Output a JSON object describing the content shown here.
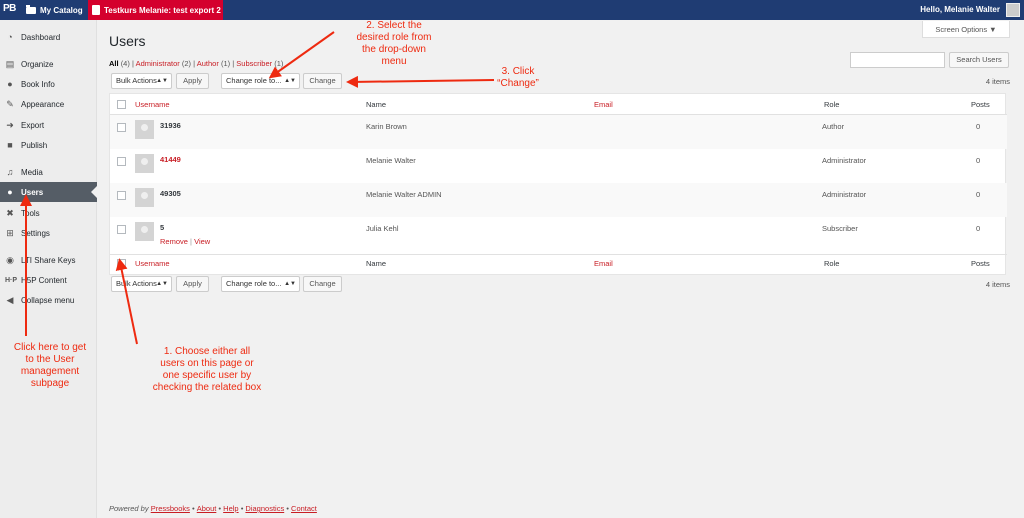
{
  "adminbar": {
    "logo": "PB",
    "catalog": "My Catalog",
    "book": "Testkurs Melanie: test export 2",
    "greeting": "Hello, Melanie Walter"
  },
  "sidebar": {
    "items": [
      {
        "label": "Dashboard",
        "icon": "gauge-icon"
      },
      {
        "label": "Organize",
        "icon": "organize-icon"
      },
      {
        "label": "Book Info",
        "icon": "info-icon"
      },
      {
        "label": "Appearance",
        "icon": "brush-icon"
      },
      {
        "label": "Export",
        "icon": "export-icon"
      },
      {
        "label": "Publish",
        "icon": "publish-icon"
      },
      {
        "label": "Media",
        "icon": "media-icon"
      },
      {
        "label": "Users",
        "icon": "user-icon",
        "active": true
      },
      {
        "label": "Tools",
        "icon": "wrench-icon"
      },
      {
        "label": "Settings",
        "icon": "settings-icon"
      },
      {
        "label": "LTI Share Keys",
        "icon": "lti-icon"
      },
      {
        "label": "H5P Content",
        "icon": "h5p-icon"
      },
      {
        "label": "Collapse menu",
        "icon": "collapse-icon"
      }
    ]
  },
  "page": {
    "title": "Users",
    "screen_options": "Screen Options ▼",
    "filters": {
      "all": "All",
      "all_count": "(4)",
      "administrator": "Administrator",
      "administrator_count": "(2)",
      "author": "Author",
      "author_count": "(1)",
      "subscriber": "Subscriber",
      "subscriber_count": "(1)",
      "separator": "|"
    },
    "search_button": "Search Users",
    "bulk_actions": "Bulk Actions",
    "apply": "Apply",
    "change_role": "Change role to...",
    "change": "Change",
    "items_count": "4 items"
  },
  "table": {
    "headers": {
      "username": "Username",
      "name": "Name",
      "email": "Email",
      "role": "Role",
      "posts": "Posts"
    },
    "rows": [
      {
        "username": "31936",
        "name": "Karin Brown",
        "role": "Author",
        "posts": "0",
        "link": false
      },
      {
        "username": "41449",
        "name": "Melanie Walter",
        "role": "Administrator",
        "posts": "0",
        "link": true
      },
      {
        "username": "49305",
        "name": "Melanie Walter ADMIN",
        "role": "Administrator",
        "posts": "0",
        "link": false
      },
      {
        "username": "5",
        "name": "Julia Kehl",
        "role": "Subscriber",
        "posts": "0",
        "link": false,
        "actions": [
          "Remove",
          "View"
        ]
      }
    ]
  },
  "footer": {
    "powered_by": "Powered by",
    "pressbooks": "Pressbooks",
    "bullet": "•",
    "about": "About",
    "help": "Help",
    "diagnostics": "Diagnostics",
    "contact": "Contact"
  },
  "annotations": {
    "step1": "1. Choose either all\nusers on this page or\none specific user by\nchecking the related box",
    "step2": "2. Select the\ndesired role from\nthe drop-down\nmenu",
    "step3": "3. Click\n“Change”",
    "users_hint": "Click here to get\nto the User\nmanagement\nsubpage",
    "color": "#ee2a10"
  }
}
